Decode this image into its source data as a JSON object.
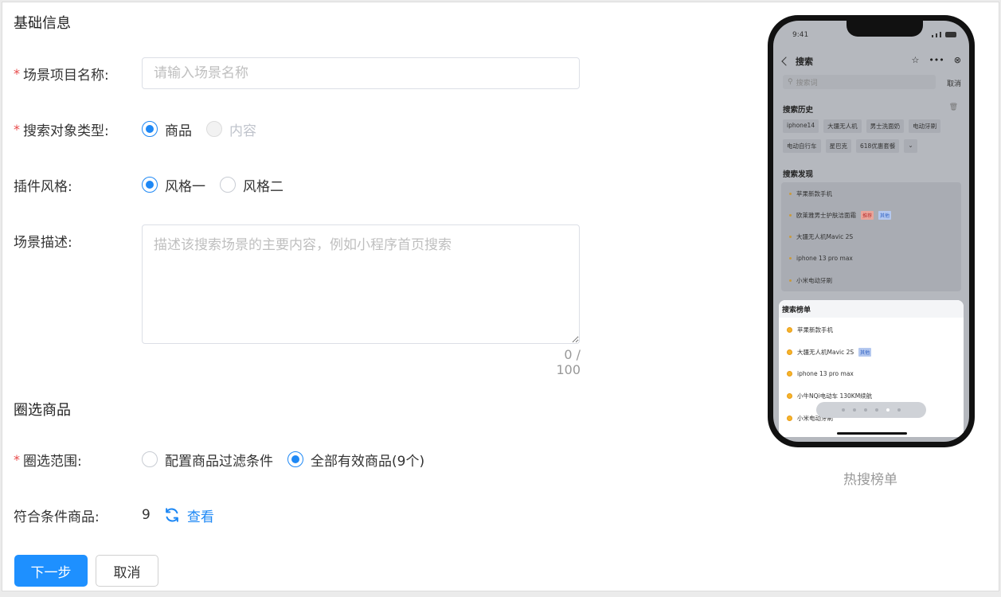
{
  "section1": {
    "title": "基础信息"
  },
  "fields": {
    "scene_name": {
      "label": "场景项目名称:",
      "placeholder": "请输入场景名称",
      "value": ""
    },
    "search_type": {
      "label": "搜索对象类型:",
      "options": [
        "商品",
        "内容"
      ],
      "selected": "商品"
    },
    "plugin_style": {
      "label": "插件风格:",
      "options": [
        "风格一",
        "风格二"
      ],
      "selected": "风格一"
    },
    "scene_desc": {
      "label": "场景描述:",
      "placeholder": "描述该搜索场景的主要内容，例如小程序首页搜索",
      "counter": "0 / 100"
    }
  },
  "section2": {
    "title": "圈选商品"
  },
  "scope": {
    "label": "圈选范围:",
    "options": [
      "配置商品过滤条件",
      "全部有效商品(9个)"
    ],
    "selected": "全部有效商品(9个)"
  },
  "matched": {
    "label": "符合条件商品:",
    "count": "9",
    "view_link": "查看"
  },
  "buttons": {
    "next": "下一步",
    "cancel": "取消"
  },
  "preview": {
    "caption": "热搜榜单",
    "status_time": "9:41",
    "nav_title": "搜索",
    "search_placeholder": "搜索词",
    "cancel": "取消",
    "history_title": "搜索历史",
    "history_tags_row1": [
      "iphone14",
      "大疆无人机",
      "男士洗面奶",
      "电动牙刷"
    ],
    "history_tags_row2": [
      "电动自行车",
      "星巴克",
      "618优惠套餐"
    ],
    "discover_title": "搜索发现",
    "discover_items": [
      {
        "text": "苹果新款手机"
      },
      {
        "text": "欧莱雅男士护肤洁面霜",
        "badges": [
          "推荐",
          "其他"
        ]
      },
      {
        "text": "大疆无人机Mavic 2S"
      },
      {
        "text": "iphone 13 pro max"
      },
      {
        "text": "小米电动牙刷"
      }
    ],
    "ranking_title": "搜索榜单",
    "ranking_items": [
      {
        "text": "苹果新款手机"
      },
      {
        "text": "大疆无人机Mavic 2S",
        "badge": "其他"
      },
      {
        "text": "iphone 13 pro max"
      },
      {
        "text": "小牛NQi电动车 130KM续航"
      },
      {
        "text": "小米电动牙刷"
      }
    ],
    "pager": {
      "total": 6,
      "active_index": 4
    }
  }
}
